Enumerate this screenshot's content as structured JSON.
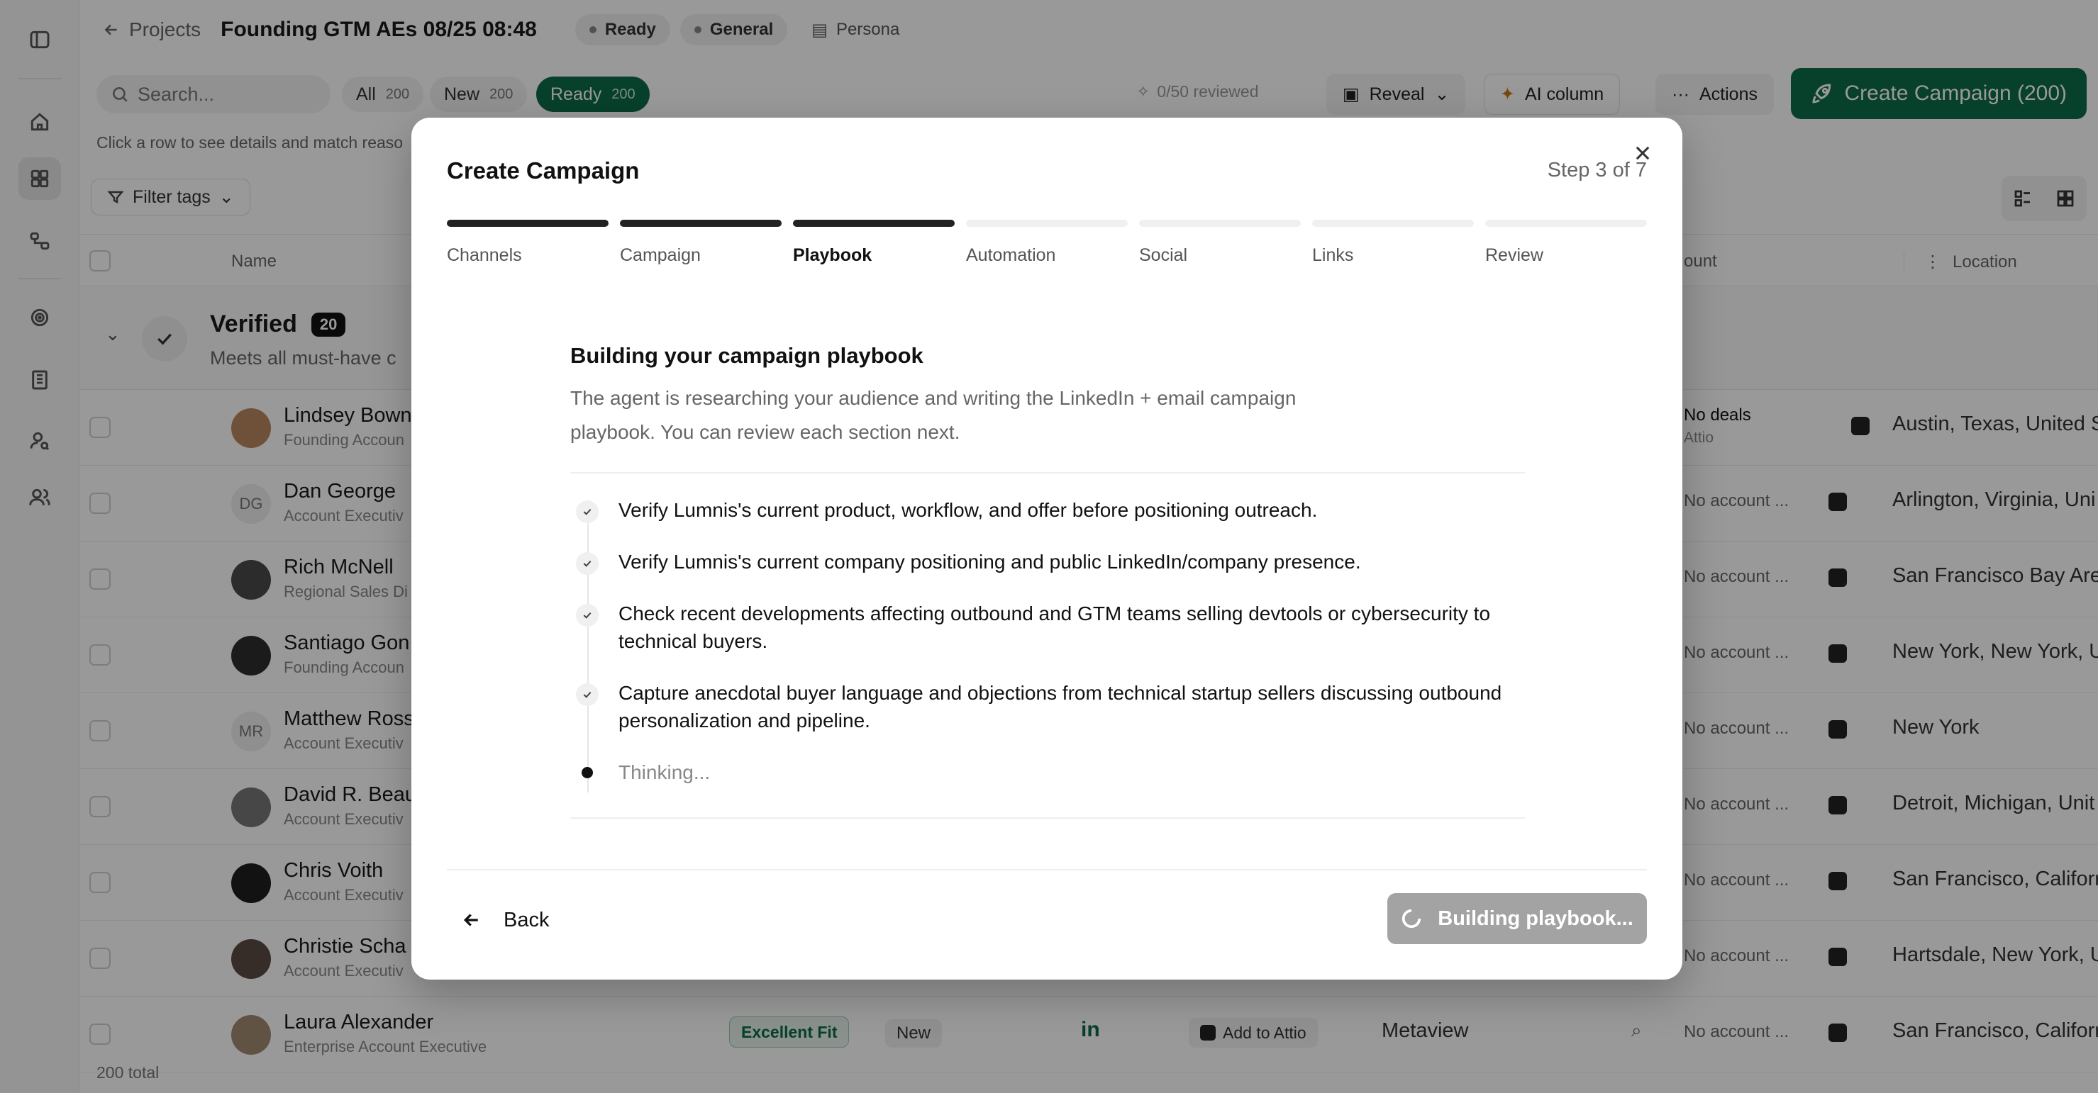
{
  "header": {
    "back_label": "Projects",
    "project_title": "Founding GTM AEs 08/25 08:48",
    "status_chip": "Ready",
    "type_chip": "General",
    "persona_chip": "Persona"
  },
  "toolbar": {
    "search_placeholder": "Search...",
    "filters": [
      {
        "label": "All",
        "count": "200"
      },
      {
        "label": "New",
        "count": "200"
      },
      {
        "label": "Ready",
        "count": "200"
      }
    ],
    "reviewed": "0/50 reviewed",
    "reveal_label": "Reveal",
    "ai_column_label": "AI column",
    "actions_label": "Actions",
    "create_campaign_label": "Create Campaign  (200)"
  },
  "hint": "Click a row to see details and match reaso",
  "filter_tags_label": "Filter tags",
  "table": {
    "col_name": "Name",
    "col_account": "ount",
    "col_location": "Location",
    "group": {
      "title": "Verified",
      "count": "20",
      "subtitle": "Meets all must-have c"
    },
    "rows": [
      {
        "name": "Lindsey Bown",
        "title": "Founding Accoun",
        "initials": "",
        "account": "No deals",
        "account_sub": "Attio",
        "location": "Austin, Texas, United S"
      },
      {
        "name": "Dan George",
        "title": "Account Executiv",
        "initials": "DG",
        "account": "No account ...",
        "location": "Arlington, Virginia, Uni"
      },
      {
        "name": "Rich McNell",
        "title": "Regional Sales Di",
        "initials": "",
        "account": "No account ...",
        "location": "San Francisco Bay Are"
      },
      {
        "name": "Santiago Gon:",
        "title": "Founding Accoun",
        "initials": "",
        "account": "No account ...",
        "location": "New York, New York, U"
      },
      {
        "name": "Matthew Ross",
        "title": "Account Executiv",
        "initials": "MR",
        "account": "No account ...",
        "location": "New York"
      },
      {
        "name": "David R. Beau",
        "title": "Account Executiv",
        "initials": "",
        "account": "No account ...",
        "location": "Detroit, Michigan, Unit"
      },
      {
        "name": "Chris Voith",
        "title": "Account Executiv",
        "initials": "",
        "account": "No account ...",
        "location": "San Francisco, Califorr"
      },
      {
        "name": "Christie Scha",
        "title": "Account Executiv",
        "initials": "",
        "account": "No account ...",
        "location": "Hartsdale, New York, U"
      },
      {
        "name": "Laura Alexander",
        "title": "Enterprise Account Executive",
        "initials": "",
        "fit": "Excellent Fit",
        "status": "New",
        "linkedin": "in",
        "add_attio": "Add to Attio",
        "company": "Metaview",
        "account": "No account ...",
        "location": "San Francisco, Califorr"
      }
    ],
    "total": "200 total"
  },
  "modal": {
    "title": "Create Campaign",
    "step_label": "Step 3 of 7",
    "steps": [
      "Channels",
      "Campaign",
      "Playbook",
      "Automation",
      "Social",
      "Links",
      "Review"
    ],
    "current_step": 3,
    "heading": "Building your campaign playbook",
    "description": "The agent is researching your audience and writing the LinkedIn + email campaign playbook. You can review each section next.",
    "tasks": [
      "Verify Lumnis's current product, workflow, and offer before positioning outreach.",
      "Verify Lumnis's current company positioning and public LinkedIn/company presence.",
      "Check recent developments affecting outbound and GTM teams selling devtools or cybersecurity to technical buyers.",
      "Capture anecdotal buyer language and objections from technical startup sellers discussing outbound personalization and pipeline."
    ],
    "thinking": "Thinking...",
    "back_label": "Back",
    "building_label": "Building playbook..."
  },
  "colors": {
    "accent": "#0d6b49",
    "overlay": "rgba(0,0,0,0.40)"
  }
}
